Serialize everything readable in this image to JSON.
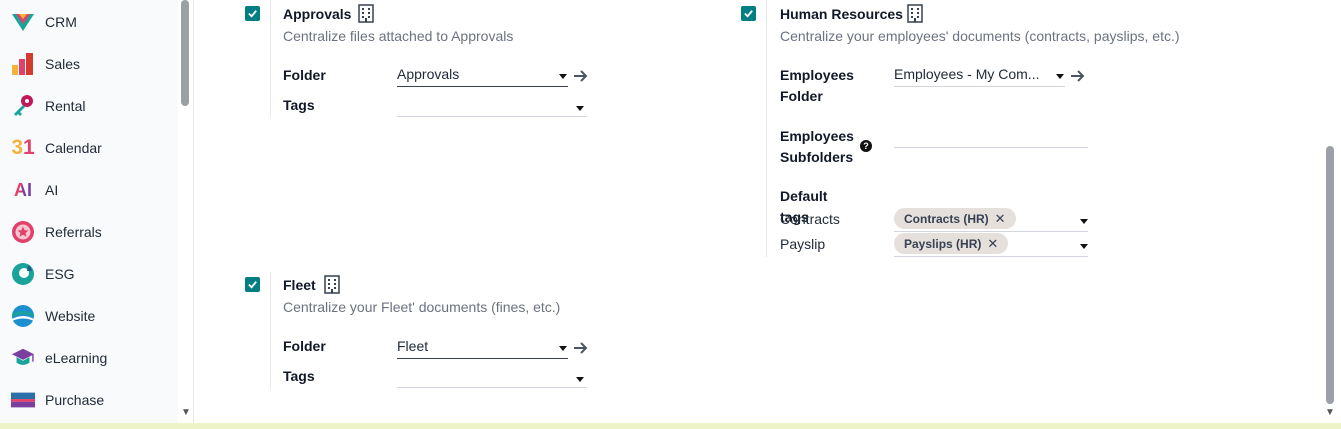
{
  "sidebar": {
    "items": [
      {
        "label": "CRM",
        "icon": "crm-icon"
      },
      {
        "label": "Sales",
        "icon": "sales-icon"
      },
      {
        "label": "Rental",
        "icon": "rental-icon"
      },
      {
        "label": "Calendar",
        "icon": "calendar-icon",
        "icon_text": "31"
      },
      {
        "label": "AI",
        "icon": "ai-icon",
        "icon_text": "AI"
      },
      {
        "label": "Referrals",
        "icon": "referrals-icon"
      },
      {
        "label": "ESG",
        "icon": "esg-icon"
      },
      {
        "label": "Website",
        "icon": "website-icon"
      },
      {
        "label": "eLearning",
        "icon": "elearning-icon"
      },
      {
        "label": "Purchase",
        "icon": "purchase-icon"
      }
    ]
  },
  "approvals": {
    "title": "Approvals",
    "description": "Centralize files attached to Approvals",
    "folder_label": "Folder",
    "folder_value": "Approvals",
    "tags_label": "Tags",
    "checked": true
  },
  "hr": {
    "title": "Human Resources",
    "description": "Centralize your employees' documents (contracts, payslips, etc.)",
    "employees_folder_label_1": "Employees",
    "employees_folder_label_2": "Folder",
    "employees_folder_value": "Employees - My Com...",
    "employees_subfolders_label_1": "Employees",
    "employees_subfolders_label_2": "Subfolders",
    "help_glyph": "?",
    "default_tags_label": "Default tags",
    "contracts_label": "Contracts",
    "contracts_tag": "Contracts (HR)",
    "payslip_label": "Payslip",
    "payslip_tag": "Payslips (HR)",
    "remove_glyph": "✕",
    "checked": true
  },
  "fleet": {
    "title": "Fleet",
    "description": "Centralize your Fleet' documents (fines, etc.)",
    "folder_label": "Folder",
    "folder_value": "Fleet",
    "tags_label": "Tags",
    "checked": true
  },
  "colors": {
    "accent": "#017e84",
    "tag_bg": "#e5e0dc"
  }
}
